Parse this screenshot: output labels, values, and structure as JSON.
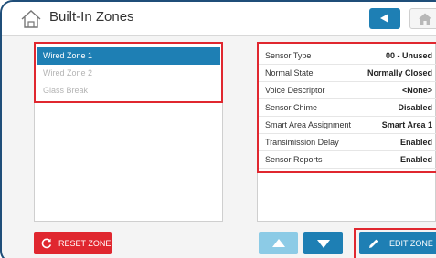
{
  "header": {
    "title": "Built-In Zones"
  },
  "zones": [
    {
      "label": "Wired Zone 1",
      "selected": true
    },
    {
      "label": "Wired Zone 2",
      "selected": false
    },
    {
      "label": "Glass Break",
      "selected": false
    }
  ],
  "sensor_details": [
    {
      "label": "Sensor Type",
      "value": "00 - Unused"
    },
    {
      "label": "Normal State",
      "value": "Normally Closed"
    },
    {
      "label": "Voice Descriptor",
      "value": "<None>"
    },
    {
      "label": "Sensor Chime",
      "value": "Disabled"
    },
    {
      "label": "Smart Area Assignment",
      "value": "Smart Area 1"
    },
    {
      "label": "Transimission Delay",
      "value": "Enabled"
    },
    {
      "label": "Sensor Reports",
      "value": "Enabled"
    }
  ],
  "buttons": {
    "reset_zone": "RESET ZONE",
    "edit_zone": "EDIT ZONE"
  },
  "icons": {
    "title": "house-outline-icon",
    "back": "back-arrow-icon",
    "home": "home-icon",
    "reset": "reset-icon",
    "edit": "pencil-icon",
    "up": "arrow-up-icon",
    "down": "arrow-down-icon"
  },
  "colors": {
    "accent_blue": "#1e7fb4",
    "light_blue": "#8ccbe6",
    "danger_red": "#e0272f",
    "frame_border": "#1f4e79"
  }
}
